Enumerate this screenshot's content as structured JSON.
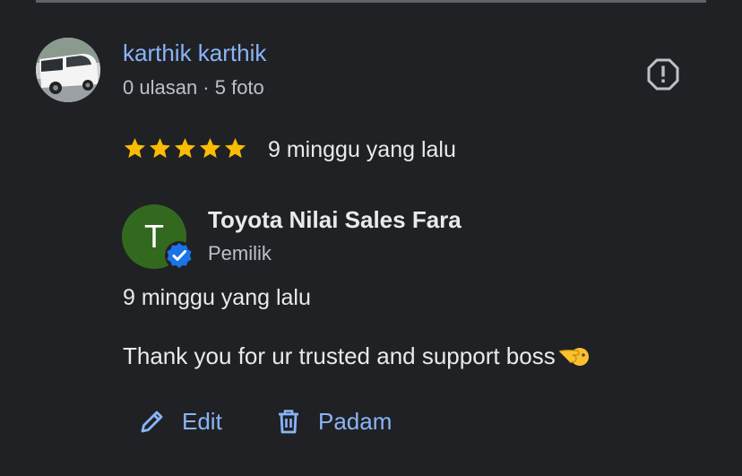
{
  "reviewer": {
    "name": "karthik karthik",
    "meta": "0 ulasan · 5 foto"
  },
  "review": {
    "rating": 5,
    "rating_max": 5,
    "time": "9 minggu yang lalu"
  },
  "reply": {
    "owner_initial": "T",
    "owner_name": "Toyota Nilai Sales Fara",
    "owner_role": "Pemilik",
    "time": "9 minggu yang lalu",
    "text": "Thank you for ur trusted and support boss"
  },
  "actions": {
    "edit_label": "Edit",
    "delete_label": "Padam"
  },
  "colors": {
    "background": "#202124",
    "link": "#8ab4f8",
    "star": "#fbbc04",
    "owner_avatar": "#33691e",
    "verified": "#1a73e8"
  },
  "icons": {
    "report": "report-icon",
    "edit": "pencil-icon",
    "delete": "trash-icon",
    "verified": "verified-badge-icon",
    "emoji": "pointing-hand-emoji"
  }
}
